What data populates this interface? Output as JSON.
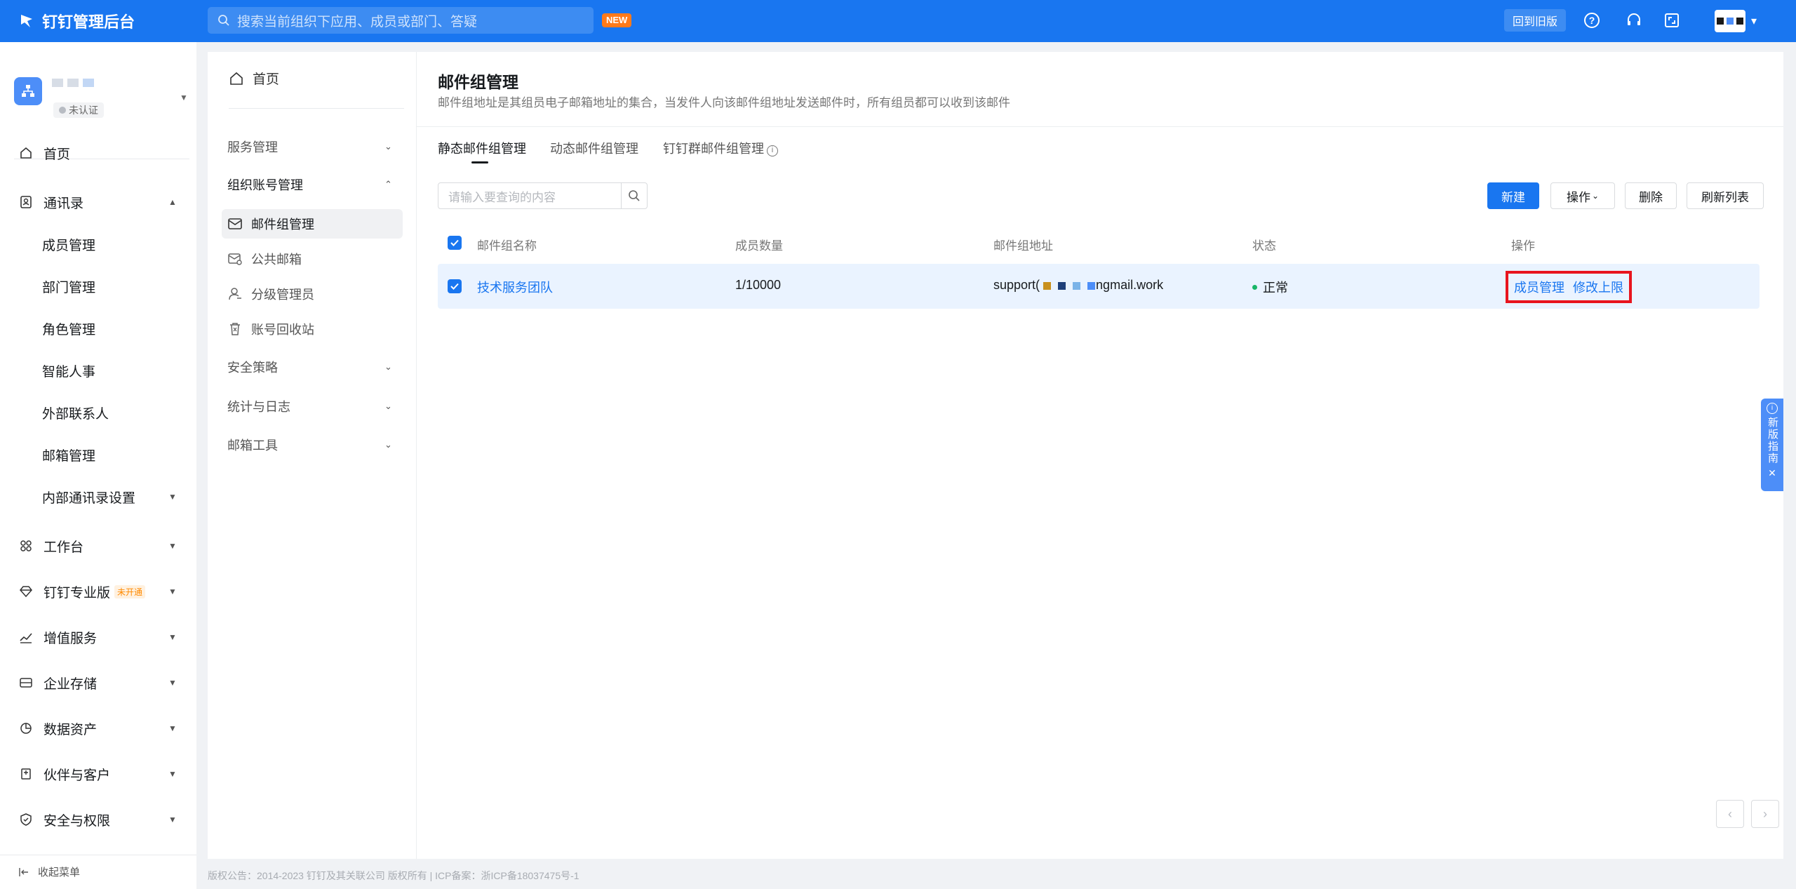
{
  "app": {
    "title": "钉钉管理后台",
    "new_badge": "NEW",
    "back_old": "回到旧版"
  },
  "search": {
    "placeholder": "搜索当前组织下应用、成员或部门、答疑"
  },
  "org": {
    "badge": "未认证"
  },
  "sidebar": {
    "items": [
      {
        "label": "首页",
        "icon": "home-icon"
      },
      {
        "label": "通讯录",
        "icon": "contacts-icon"
      },
      {
        "label": "工作台",
        "icon": "grid-icon"
      },
      {
        "label": "钉钉专业版",
        "icon": "diamond-icon",
        "tag": "未开通"
      },
      {
        "label": "增值服务",
        "icon": "trend-icon"
      },
      {
        "label": "企业存储",
        "icon": "storage-icon"
      },
      {
        "label": "数据资产",
        "icon": "data-icon"
      },
      {
        "label": "伙伴与客户",
        "icon": "partner-icon"
      },
      {
        "label": "安全与权限",
        "icon": "shield-icon"
      }
    ],
    "contacts_sub": [
      "成员管理",
      "部门管理",
      "角色管理",
      "智能人事",
      "外部联系人",
      "邮箱管理",
      "内部通讯录设置"
    ],
    "collapse": "收起菜单"
  },
  "subnav": {
    "home": "首页",
    "groups": [
      "服务管理",
      "组织账号管理",
      "安全策略",
      "统计与日志",
      "邮箱工具"
    ],
    "leaves": [
      "邮件组管理",
      "公共邮箱",
      "分级管理员",
      "账号回收站"
    ]
  },
  "main": {
    "title": "邮件组管理",
    "desc": "邮件组地址是其组员电子邮箱地址的集合，当发件人向该邮件组地址发送邮件时，所有组员都可以收到该邮件",
    "tabs": [
      "静态邮件组管理",
      "动态邮件组管理",
      "钉钉群邮件组管理"
    ],
    "query_placeholder": "请输入要查询的内容",
    "buttons": {
      "new": "新建",
      "ops": "操作",
      "delete": "删除",
      "refresh": "刷新列表"
    },
    "columns": [
      "邮件组名称",
      "成员数量",
      "邮件组地址",
      "状态",
      "操作"
    ],
    "rows": [
      {
        "name": "技术服务团队",
        "count": "1/10000",
        "addr_prefix": "support(",
        "addr_suffix": "ngmail.work",
        "status": "正常",
        "actions": [
          "成员管理",
          "修改上限"
        ]
      }
    ]
  },
  "guide": {
    "label": "新版指南"
  },
  "footer": "版权公告：2014-2023 钉钉及其关联公司 版权所有 | ICP备案：浙ICP备18037475号-1",
  "colors": {
    "brand": "#1976f0",
    "highlight": "#e8141e",
    "status_ok": "#18b567"
  }
}
